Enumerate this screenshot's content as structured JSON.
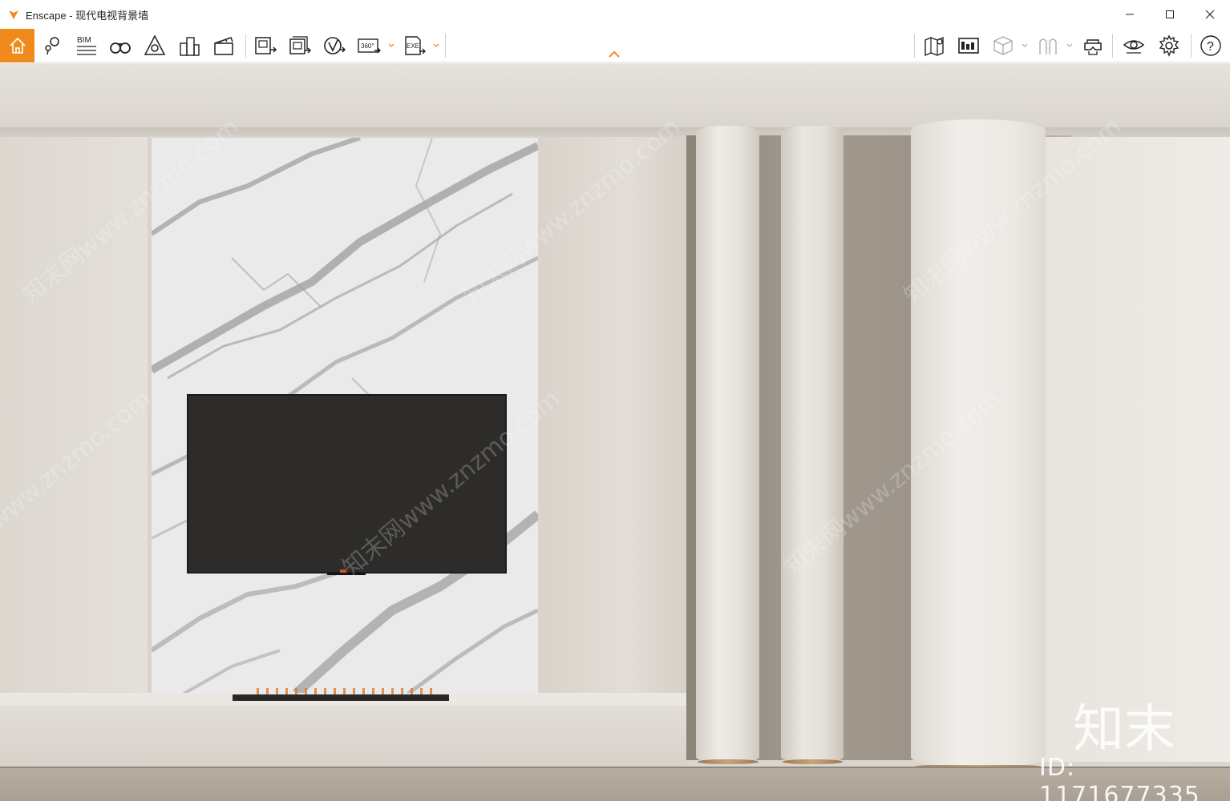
{
  "window": {
    "app_name": "Enscape",
    "title": "Enscape - 现代电视背景墙",
    "controls": [
      "—",
      "☐",
      "✕"
    ]
  },
  "toolbar": {
    "left_groups": [
      {
        "icon": "home-icon"
      },
      {
        "icon": "pin-icon"
      },
      {
        "icon": "bim-icon",
        "label": "BIM"
      },
      {
        "icon": "binoculars-icon"
      },
      {
        "icon": "navigation-icon"
      },
      {
        "icon": "buildings-icon"
      },
      {
        "icon": "clapperboard-icon"
      },
      {
        "icon": "render-image-icon"
      },
      {
        "icon": "batch-render-icon"
      },
      {
        "icon": "render-video-icon"
      },
      {
        "icon": "panorama-icon",
        "label": "360°"
      },
      {
        "icon": "export-exe-icon",
        "label": "EXE"
      }
    ],
    "right_groups": [
      {
        "icon": "map-icon"
      },
      {
        "icon": "view-management-icon"
      },
      {
        "icon": "cube-icon"
      },
      {
        "icon": "asset-library-icon"
      },
      {
        "icon": "vr-headset-icon"
      },
      {
        "icon": "eye-icon"
      },
      {
        "icon": "settings-icon"
      },
      {
        "icon": "help-icon",
        "label": "?"
      }
    ],
    "accent_color": "#f08a1c"
  },
  "viewport": {
    "watermarks": [
      "知末网www.znzmo.com",
      "知末网www.znzmo.com",
      "知末网www.znzmo.com",
      "知末网www.znzmo.com",
      "知末网www.znzmo.com",
      "知末网www.znzmo.com"
    ],
    "brand_mark": "知末",
    "id_mark": "ID: 1171677335"
  }
}
